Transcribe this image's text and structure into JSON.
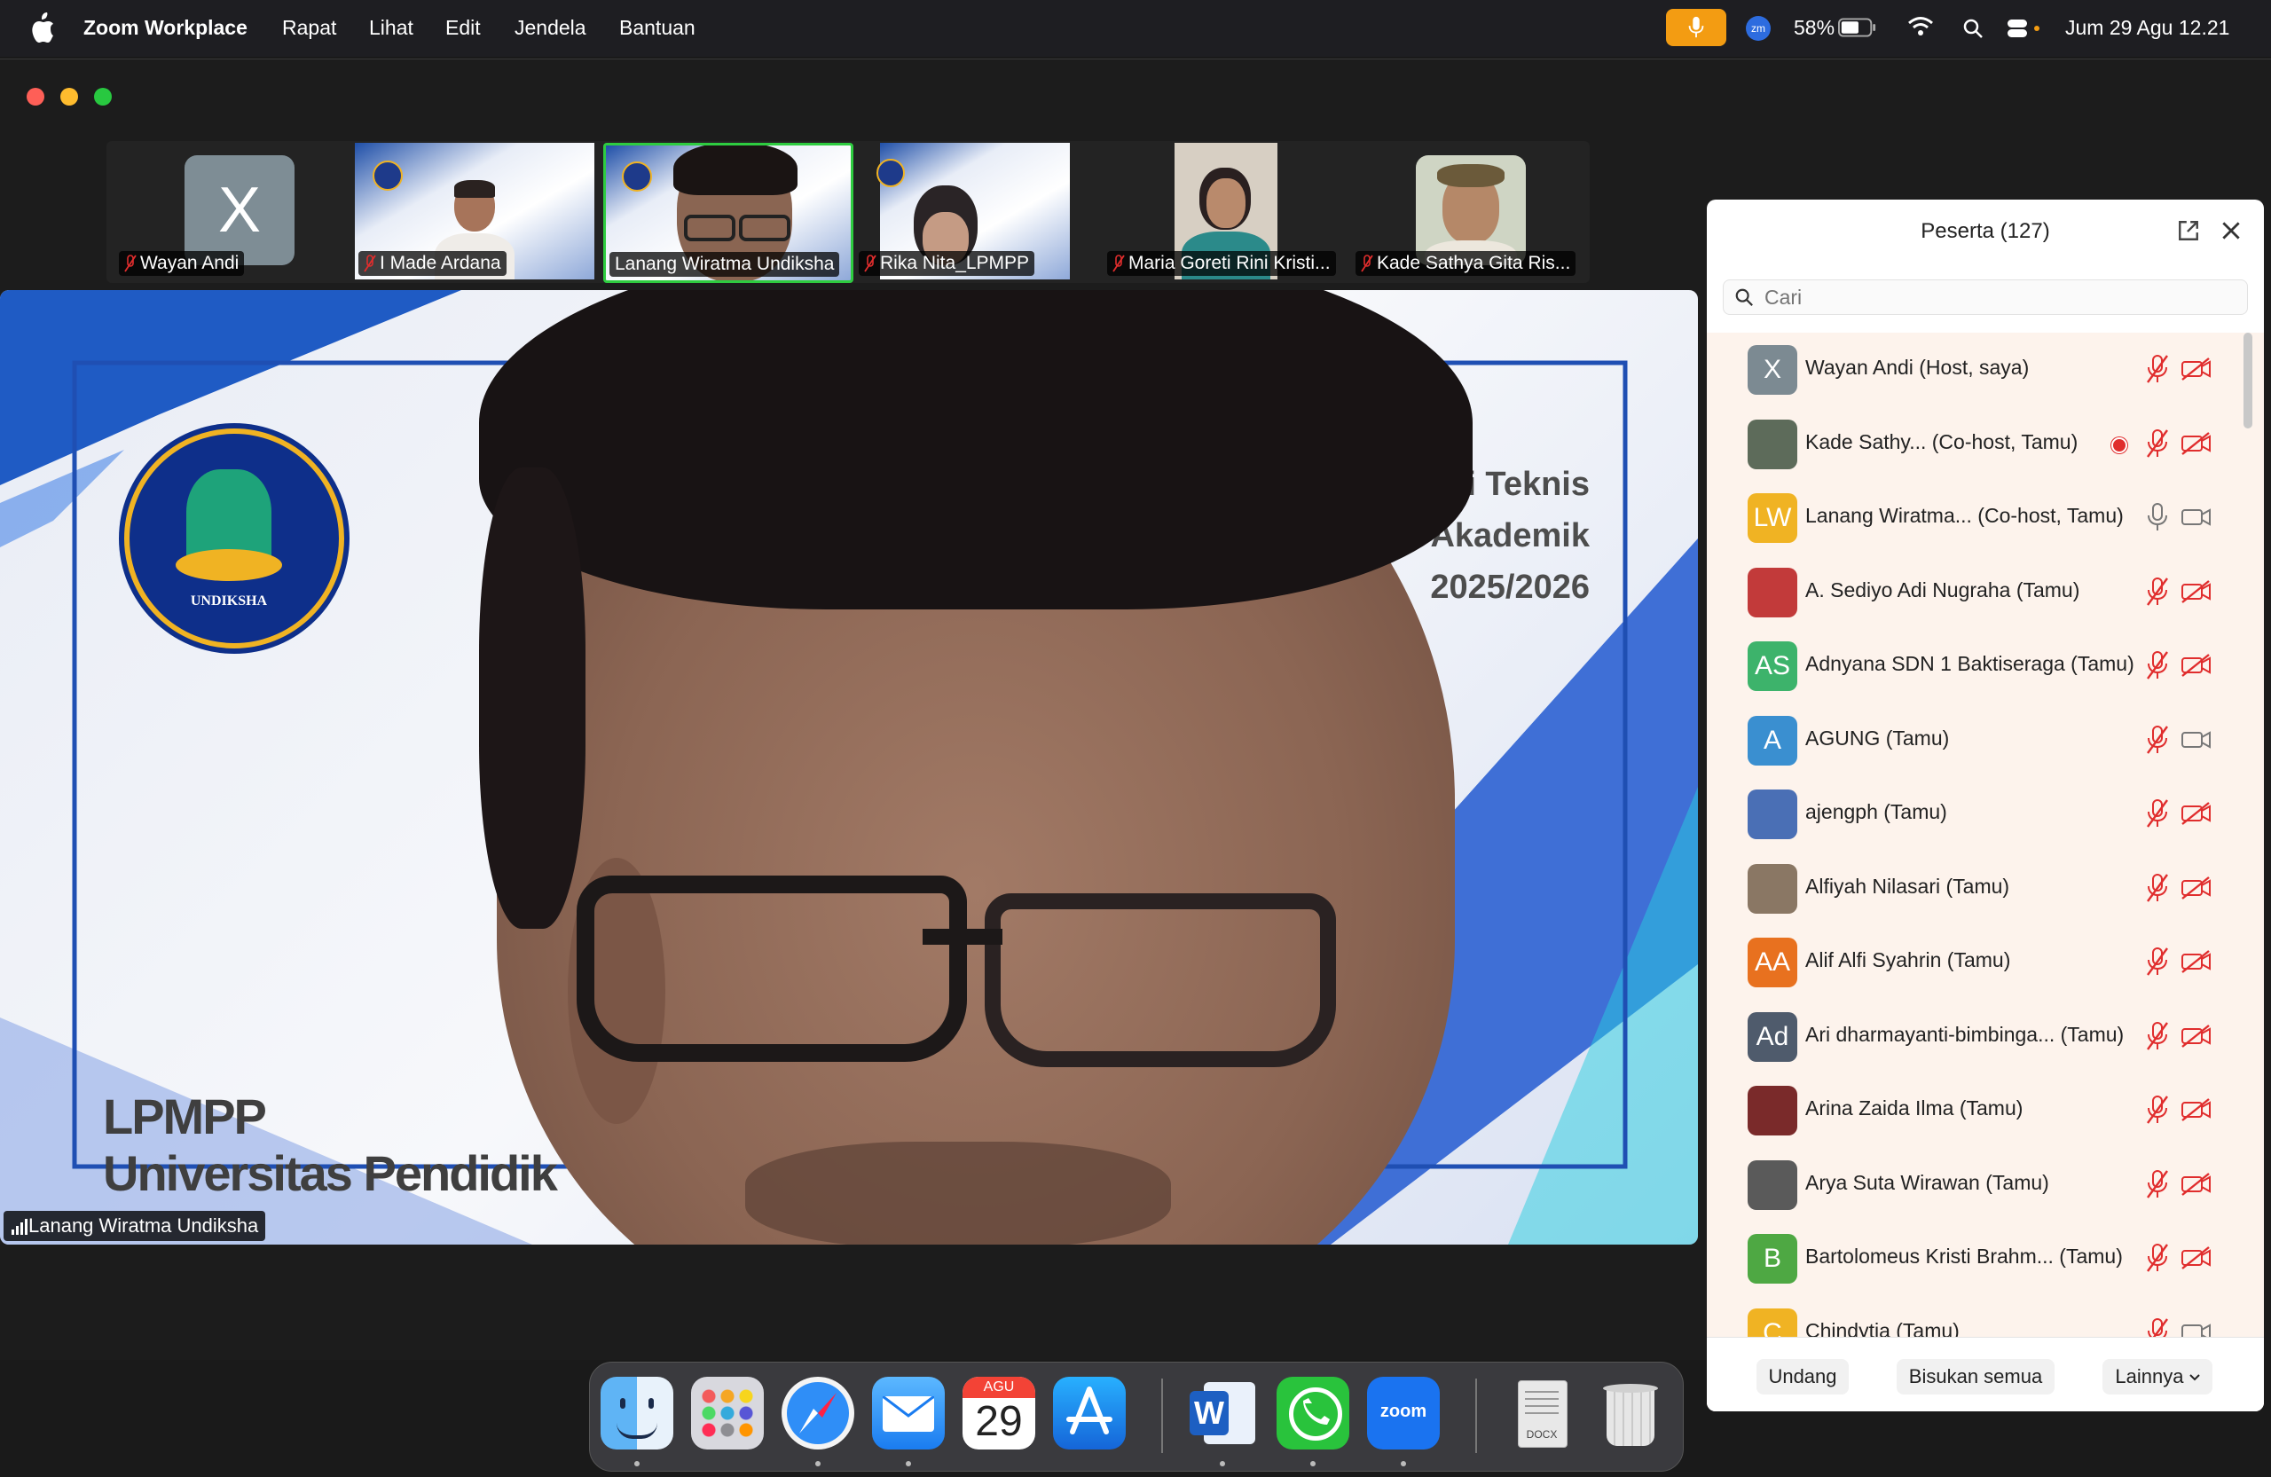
{
  "menubar": {
    "app_name": "Zoom Workplace",
    "menus": [
      "Rapat",
      "Lihat",
      "Edit",
      "Jendela",
      "Bantuan"
    ],
    "battery": "58%",
    "datetime": "Jum 29 Agu  12.21"
  },
  "thumbnails": [
    {
      "name": "Wayan Andi",
      "initial": "X",
      "muted": true
    },
    {
      "name": "I Made Ardana",
      "muted": true
    },
    {
      "name": "Lanang Wiratma Undiksha",
      "muted": false,
      "active": true
    },
    {
      "name": "Rika Nita_LPMPP",
      "muted": true
    },
    {
      "name": "Maria Goreti Rini Kristi...",
      "muted": true
    },
    {
      "name": "Kade Sathya Gita Ris...",
      "muted": true
    }
  ],
  "main_video": {
    "slide_title_lines": [
      "osialisasi Teknis",
      "ahun Akademik",
      "2025/2026"
    ],
    "slide_org_lines": [
      "LPMPP",
      "Universitas Pendidik"
    ],
    "logo_text": "UNDIKSHA",
    "speaker_label": "Lanang Wiratma Undiksha"
  },
  "panel": {
    "title": "Peserta (127)",
    "search_placeholder": "Cari",
    "participants": [
      {
        "initials": "X",
        "name": "Wayan Andi (Host, saya)",
        "color": "#7c8a92",
        "mic": "muted",
        "cam": "off"
      },
      {
        "initials": "",
        "name": "Kade Sathy...  (Co-host, Tamu)",
        "color": "#5d6b5a",
        "mic": "muted",
        "cam": "off",
        "recording": true
      },
      {
        "initials": "LW",
        "name": "Lanang Wiratma...  (Co-host, Tamu)",
        "color": "#f0b323",
        "mic": "on",
        "cam": "on"
      },
      {
        "initials": "",
        "name": "A. Sediyo Adi Nugraha (Tamu)",
        "color": "#c23a3a",
        "mic": "muted",
        "cam": "off"
      },
      {
        "initials": "AS",
        "name": "Adnyana SDN 1 Baktiseraga  (Tamu)",
        "color": "#3db36b",
        "mic": "muted",
        "cam": "off"
      },
      {
        "initials": "A",
        "name": "AGUNG (Tamu)",
        "color": "#3a8fd0",
        "mic": "muted",
        "cam": "on"
      },
      {
        "initials": "",
        "name": "ajengph (Tamu)",
        "color": "#4a6fb5",
        "mic": "muted",
        "cam": "off"
      },
      {
        "initials": "",
        "name": "Alfiyah Nilasari (Tamu)",
        "color": "#8a7764",
        "mic": "muted",
        "cam": "off"
      },
      {
        "initials": "AA",
        "name": "Alif Alfi Syahrin (Tamu)",
        "color": "#e8711f",
        "mic": "muted",
        "cam": "off"
      },
      {
        "initials": "Ad",
        "name": "Ari dharmayanti-bimbinga...  (Tamu)",
        "color": "#4f5b6c",
        "mic": "muted",
        "cam": "off"
      },
      {
        "initials": "",
        "name": "Arina Zaida Ilma (Tamu)",
        "color": "#7a2a2a",
        "mic": "muted",
        "cam": "off"
      },
      {
        "initials": "",
        "name": "Arya Suta Wirawan (Tamu)",
        "color": "#5a5a5a",
        "mic": "muted",
        "cam": "off"
      },
      {
        "initials": "B",
        "name": "Bartolomeus Kristi Brahm...  (Tamu)",
        "color": "#4ea843",
        "mic": "muted",
        "cam": "off"
      },
      {
        "initials": "C",
        "name": "Chindytia (Tamu)",
        "color": "#f0b323",
        "mic": "muted",
        "cam": "on"
      }
    ],
    "footer": {
      "invite": "Undang",
      "mute_all": "Bisukan semua",
      "more": "Lainnya"
    }
  },
  "dock": {
    "calendar_month": "AGU",
    "calendar_day": "29",
    "zoom_label": "zoom",
    "docx_label": "DOCX"
  },
  "colors": {
    "accent_mic": "#f39c12",
    "muted_red": "#e02d2d",
    "active_border": "#2ecc40"
  }
}
